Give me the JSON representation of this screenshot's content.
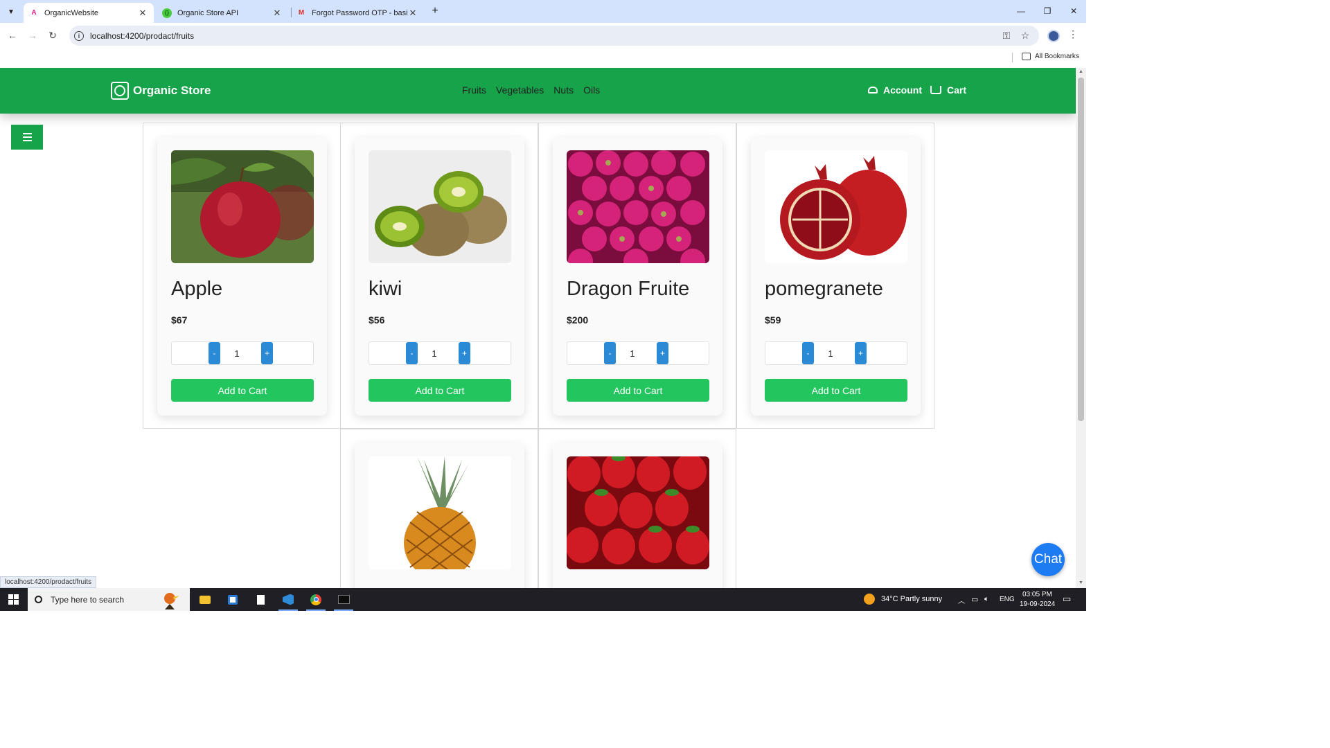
{
  "browser": {
    "tabs": [
      {
        "title": "OrganicWebsite",
        "active": true
      },
      {
        "title": "Organic Store API",
        "active": false
      },
      {
        "title": "Forgot Password OTP - basilah",
        "active": false
      }
    ],
    "url": "localhost:4200/prodact/fruits",
    "bookmarks_label": "All Bookmarks",
    "status_url": "localhost:4200/prodact/fruits"
  },
  "site": {
    "brand": "Organic Store",
    "nav": [
      "Fruits",
      "Vegetables",
      "Nuts",
      "Oils"
    ],
    "account_label": "Account",
    "cart_label": "Cart",
    "chat_label": "Chat"
  },
  "products": [
    {
      "name": "Apple",
      "price": "$67",
      "qty": "1",
      "add_label": "Add to Cart"
    },
    {
      "name": "kiwi",
      "price": "$56",
      "qty": "1",
      "add_label": "Add to Cart"
    },
    {
      "name": "Dragon Fruite",
      "price": "$200",
      "qty": "1",
      "add_label": "Add to Cart"
    },
    {
      "name": "pomegranete",
      "price": "$59",
      "qty": "1",
      "add_label": "Add to Cart"
    },
    {
      "name": "",
      "price": "",
      "qty": "",
      "add_label": ""
    },
    {
      "name": "",
      "price": "",
      "qty": "",
      "add_label": ""
    }
  ],
  "qty_minus": "-",
  "qty_plus": "+",
  "taskbar": {
    "search_placeholder": "Type here to search",
    "weather": "34°C  Partly sunny",
    "lang": "ENG",
    "time": "03:05 PM",
    "date": "19-09-2024"
  },
  "colors": {
    "header_green": "#16a34a",
    "add_button_green": "#22c55e",
    "qty_button_blue": "#2b8ad6",
    "chat_blue": "#1d7cf2"
  }
}
